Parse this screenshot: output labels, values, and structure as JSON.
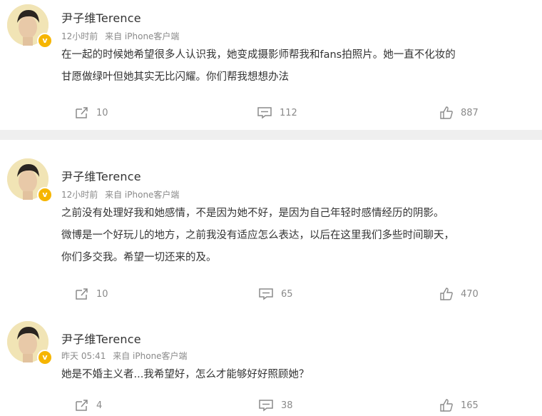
{
  "posts": [
    {
      "username": "尹子维Terence",
      "time": "12小时前",
      "source": "来自 iPhone客户端",
      "lines": [
        "在一起的时候她希望很多人认识我，她变成摄影师帮我和fans拍照片。她一直不化妆的",
        "甘愿做绿叶但她其实无比闪耀。你们帮我想想办法"
      ],
      "reposts": "10",
      "comments": "112",
      "likes": "887"
    },
    {
      "username": "尹子维Terence",
      "time": "12小时前",
      "source": "来自 iPhone客户端",
      "lines": [
        "之前没有处理好我和她感情，不是因为她不好，是因为自己年轻时感情经历的阴影。",
        "微博是一个好玩儿的地方，之前我没有适应怎么表达，以后在这里我们多些时间聊天，",
        "你们多交我。希望一切还来的及。"
      ],
      "reposts": "10",
      "comments": "65",
      "likes": "470"
    },
    {
      "username": "尹子维Terence",
      "time": "昨天 05:41",
      "source": "来自 iPhone客户端",
      "lines": [
        "她是不婚主义者...我希望好，怎么才能够好好照顾她？"
      ],
      "reposts": "4",
      "comments": "38",
      "likes": "165"
    }
  ],
  "icons": {
    "repost": "repost-icon",
    "comment": "comment-icon",
    "like": "thumbs-up-icon",
    "verified": "verified-badge-icon"
  },
  "colors": {
    "badge": "#f6b500",
    "meta_gray": "#8a8a8a",
    "separator": "#efefef"
  }
}
